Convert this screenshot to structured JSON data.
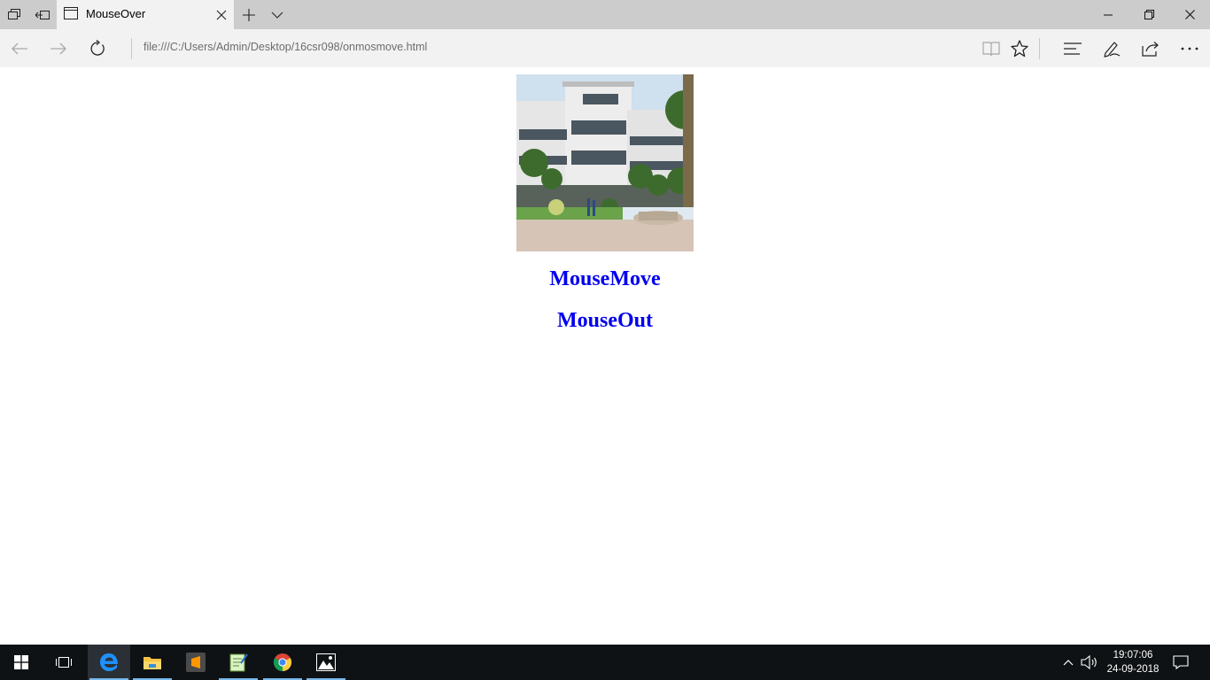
{
  "browser": {
    "tab": {
      "title": "MouseOver"
    },
    "address": {
      "url": "file:///C:/Users/Admin/Desktop/16csr098/onmosmove.html"
    }
  },
  "page": {
    "image_name": "college-building-photo",
    "headings": [
      "MouseMove",
      "MouseOut"
    ],
    "link_color": "#0000ee"
  },
  "taskbar": {
    "pinned": [
      "start",
      "task-view",
      "edge",
      "file-explorer",
      "sublime-text",
      "notepad",
      "chrome",
      "photos"
    ],
    "clock": {
      "time": "19:07:06",
      "date": "24-09-2018"
    }
  },
  "colors": {
    "tabbar": "#cccccc",
    "chrome": "#f2f2f2",
    "taskbar": "#0f1214",
    "taskbar_accent": "#76b9ed"
  }
}
